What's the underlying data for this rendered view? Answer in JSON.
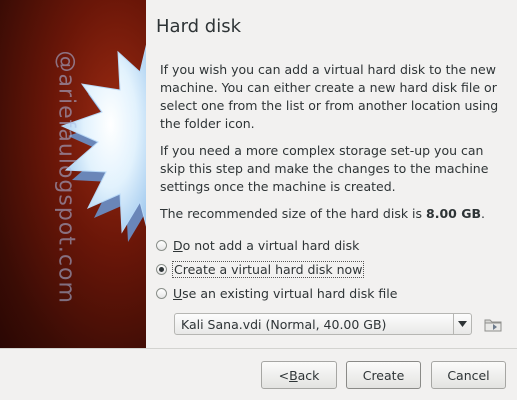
{
  "page": {
    "title": "Hard disk",
    "paragraphs": {
      "p1": "If you wish you can add a virtual hard disk to the new machine. You can either create a new hard disk file or select one from the list or from another location using the folder icon.",
      "p2": "If you need a more complex storage set-up you can skip this step and make the changes to the machine settings once the machine is created.",
      "p3_prefix": "The recommended size of the hard disk is ",
      "p3_size": "8.00 GB",
      "p3_suffix": "."
    }
  },
  "sidebar": {
    "watermark": "@ariefaulogspot.com"
  },
  "options": [
    {
      "mnemonic": "D",
      "rest": "o not add a virtual hard disk",
      "selected": false
    },
    {
      "mnemonic": "",
      "rest": "Create a virtual hard disk now",
      "selected": true
    },
    {
      "mnemonic": "U",
      "rest": "se an existing virtual hard disk file",
      "selected": false
    }
  ],
  "disk_select": {
    "value": "Kali Sana.vdi (Normal, 40.00 GB)",
    "arrow_icon": "triangle-down-icon",
    "folder_icon": "folder-icon"
  },
  "buttons": {
    "back_prefix": "< ",
    "back_mnemonic": "B",
    "back_rest": "ack",
    "create": "Create",
    "cancel": "Cancel"
  },
  "colors": {
    "sidebar_dark": "#3a0c05",
    "sidebar_red": "#9a2a12",
    "star": "#d8eefc",
    "background": "#f2f1f0"
  }
}
